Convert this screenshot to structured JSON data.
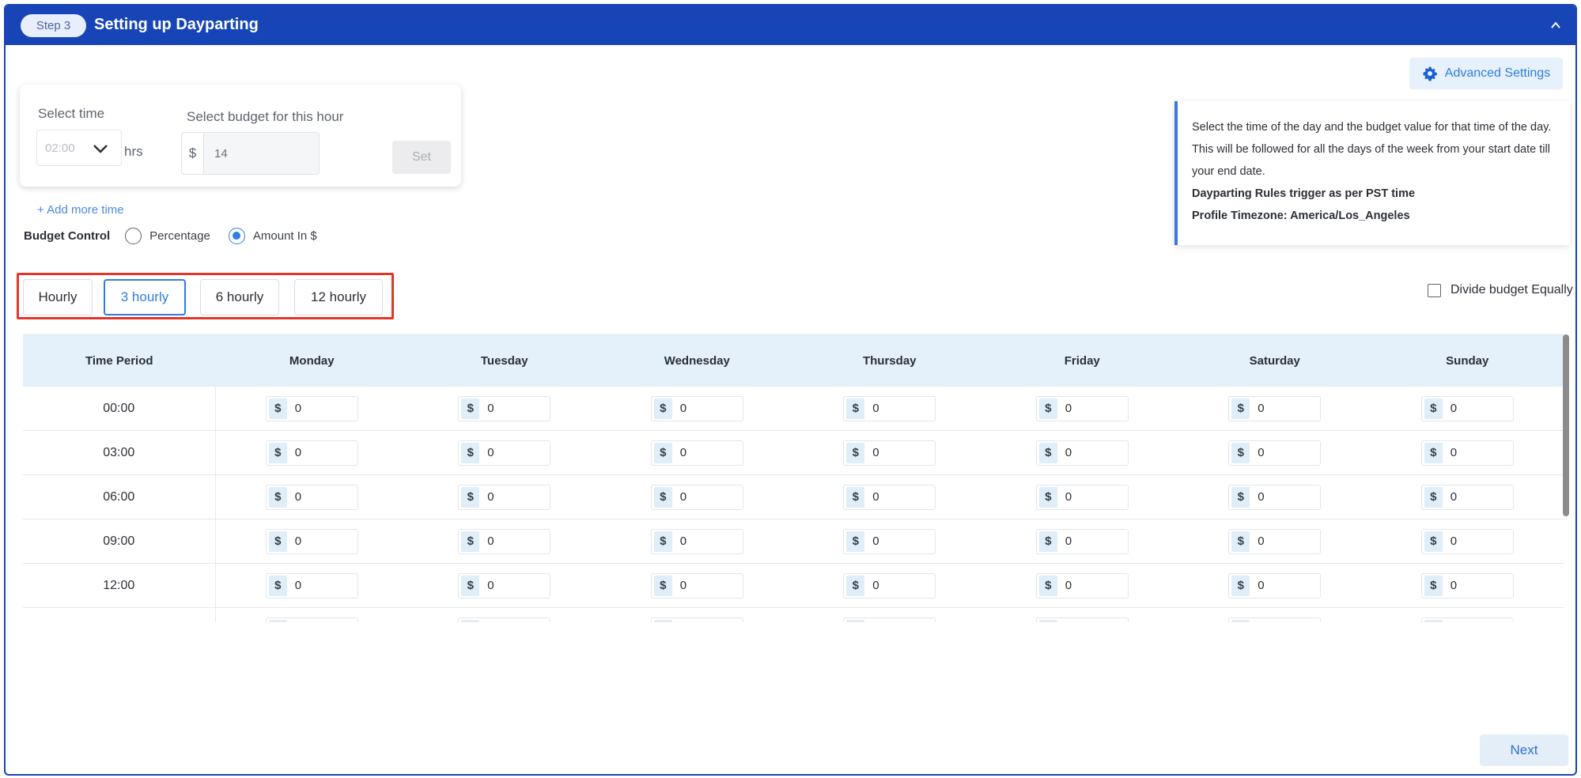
{
  "header": {
    "step_label": "Step 3",
    "title": "Setting up Dayparting",
    "collapse_icon": "chevron-up-icon"
  },
  "advanced": {
    "label": "Advanced Settings",
    "icon": "gear-icon"
  },
  "set_card": {
    "select_time_label": "Select time",
    "time_value": "02:00",
    "hrs_label": "hrs",
    "budget_label": "Select budget for this hour",
    "currency": "$",
    "budget_value": "14",
    "set_label": "Set"
  },
  "add_more": "+ Add more time",
  "budget_control": {
    "label": "Budget Control",
    "options": [
      "Percentage",
      "Amount In $"
    ],
    "selected": "Amount In $"
  },
  "info": {
    "text": "Select the time of the day and the budget value for that time of the day. This will be followed for all the days of the week from your start date till your end date.",
    "rule": "Dayparting Rules trigger as per PST time",
    "timezone": "Profile Timezone: America/Los_Angeles"
  },
  "tabs": [
    "Hourly",
    "3 hourly",
    "6 hourly",
    "12 hourly"
  ],
  "active_tab": "3 hourly",
  "divide_label": "Divide budget Equally",
  "table": {
    "headers": [
      "Time Period",
      "Monday",
      "Tuesday",
      "Wednesday",
      "Thursday",
      "Friday",
      "Saturday",
      "Sunday"
    ],
    "currency": "$",
    "rows": [
      {
        "time": "00:00",
        "values": [
          "0",
          "0",
          "0",
          "0",
          "0",
          "0",
          "0"
        ]
      },
      {
        "time": "03:00",
        "values": [
          "0",
          "0",
          "0",
          "0",
          "0",
          "0",
          "0"
        ]
      },
      {
        "time": "06:00",
        "values": [
          "0",
          "0",
          "0",
          "0",
          "0",
          "0",
          "0"
        ]
      },
      {
        "time": "09:00",
        "values": [
          "0",
          "0",
          "0",
          "0",
          "0",
          "0",
          "0"
        ]
      },
      {
        "time": "12:00",
        "values": [
          "0",
          "0",
          "0",
          "0",
          "0",
          "0",
          "0"
        ]
      }
    ]
  },
  "next_label": "Next",
  "colors": {
    "header_bg": "#1745b7",
    "accent": "#2e7de0",
    "highlight": "#e0372a"
  }
}
